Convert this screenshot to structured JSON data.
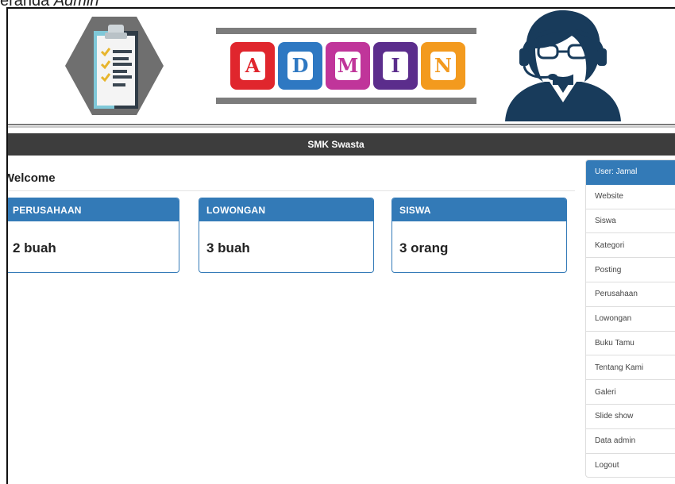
{
  "caption": {
    "prefix": "eranda ",
    "italic": "Admin"
  },
  "banner": {
    "admin_letters": [
      {
        "char": "A",
        "color": "#e0262d"
      },
      {
        "char": "D",
        "color": "#2e78c2"
      },
      {
        "char": "M",
        "color": "#c0359a"
      },
      {
        "char": "I",
        "color": "#5b2d8c"
      },
      {
        "char": "N",
        "color": "#f39a1e"
      }
    ],
    "icons": {
      "left": "clipboard-checklist-icon",
      "right": "support-agent-icon"
    }
  },
  "navbar": {
    "title": "SMK Swasta"
  },
  "main": {
    "heading": "Welcome",
    "panels": [
      {
        "title": "PERUSAHAAN",
        "value": "2 buah"
      },
      {
        "title": "LOWONGAN",
        "value": "3 buah"
      },
      {
        "title": "SISWA",
        "value": "3 orang"
      }
    ]
  },
  "sidebar": {
    "items": [
      {
        "label": "User: Jamal",
        "active": true
      },
      {
        "label": "Website"
      },
      {
        "label": "Siswa"
      },
      {
        "label": "Kategori"
      },
      {
        "label": "Posting"
      },
      {
        "label": "Perusahaan"
      },
      {
        "label": "Lowongan"
      },
      {
        "label": "Buku Tamu"
      },
      {
        "label": "Tentang Kami"
      },
      {
        "label": "Galeri"
      },
      {
        "label": "Slide show"
      },
      {
        "label": "Data admin"
      },
      {
        "label": "Logout"
      }
    ]
  },
  "colors": {
    "primary": "#337ab7",
    "navbar": "#3d3d3d"
  }
}
